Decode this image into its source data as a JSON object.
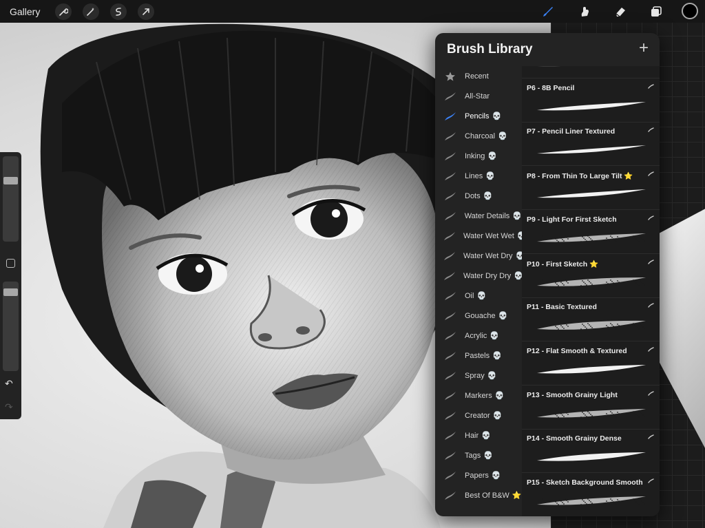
{
  "toolbar": {
    "gallery_label": "Gallery",
    "left_icons": [
      "wrench-icon",
      "magic-wand-icon",
      "selection-icon",
      "transform-arrow-icon"
    ],
    "right_icons": [
      "brush-icon",
      "smudge-icon",
      "eraser-icon",
      "layers-icon"
    ],
    "accent_color": "#3b82f6",
    "active_color": "#000000"
  },
  "sidebar": {
    "brush_size_level": 0.26,
    "opacity_level": 0.07,
    "undo_glyph": "↶",
    "redo_glyph": "↷"
  },
  "brush_library": {
    "title": "Brush Library",
    "add_glyph": "+",
    "sets": [
      {
        "label": "Recent",
        "icon": "star-icon",
        "badge": "",
        "selected": false
      },
      {
        "label": "All-Star",
        "icon": "brush-stroke-icon",
        "badge": "",
        "selected": false
      },
      {
        "label": "Pencils",
        "icon": "brush-stroke-icon",
        "badge": "💀",
        "selected": true
      },
      {
        "label": "Charcoal",
        "icon": "brush-stroke-icon",
        "badge": "💀",
        "selected": false
      },
      {
        "label": "Inking",
        "icon": "brush-stroke-icon",
        "badge": "💀",
        "selected": false
      },
      {
        "label": "Lines",
        "icon": "brush-stroke-icon",
        "badge": "💀",
        "selected": false
      },
      {
        "label": "Dots",
        "icon": "brush-stroke-icon",
        "badge": "💀",
        "selected": false
      },
      {
        "label": "Water Details",
        "icon": "brush-stroke-icon",
        "badge": "💀",
        "selected": false
      },
      {
        "label": "Water Wet Wet",
        "icon": "brush-stroke-icon",
        "badge": "💀",
        "selected": false
      },
      {
        "label": "Water Wet Dry",
        "icon": "brush-stroke-icon",
        "badge": "💀",
        "selected": false
      },
      {
        "label": "Water Dry Dry",
        "icon": "brush-stroke-icon",
        "badge": "💀",
        "selected": false
      },
      {
        "label": "Oil",
        "icon": "brush-stroke-icon",
        "badge": "💀",
        "selected": false
      },
      {
        "label": "Gouache",
        "icon": "brush-stroke-icon",
        "badge": "💀",
        "selected": false
      },
      {
        "label": "Acrylic",
        "icon": "brush-stroke-icon",
        "badge": "💀",
        "selected": false
      },
      {
        "label": "Pastels",
        "icon": "brush-stroke-icon",
        "badge": "💀",
        "selected": false
      },
      {
        "label": "Spray",
        "icon": "brush-stroke-icon",
        "badge": "💀",
        "selected": false
      },
      {
        "label": "Markers",
        "icon": "brush-stroke-icon",
        "badge": "💀",
        "selected": false
      },
      {
        "label": "Creator",
        "icon": "brush-stroke-icon",
        "badge": "💀",
        "selected": false
      },
      {
        "label": "Hair",
        "icon": "brush-stroke-icon",
        "badge": "💀",
        "selected": false
      },
      {
        "label": "Tags",
        "icon": "brush-stroke-icon",
        "badge": "💀",
        "selected": false
      },
      {
        "label": "Papers",
        "icon": "brush-stroke-icon",
        "badge": "💀",
        "selected": false
      },
      {
        "label": "Best Of B&W",
        "icon": "brush-stroke-icon",
        "badge": "⭐",
        "selected": false
      }
    ],
    "brushes": [
      {
        "label": "",
        "star": false
      },
      {
        "label": "P6 - 8B Pencil",
        "star": false
      },
      {
        "label": "P7 - Pencil Liner Textured",
        "star": false
      },
      {
        "label": "P8 - From Thin To Large Tilt",
        "star": true
      },
      {
        "label": "P9 - Light For First Sketch",
        "star": false
      },
      {
        "label": "P10 - First Sketch",
        "star": true
      },
      {
        "label": "P11 - Basic Textured",
        "star": false
      },
      {
        "label": "P12 - Flat Smooth & Textured",
        "star": false
      },
      {
        "label": "P13 - Smooth Grainy Light",
        "star": false
      },
      {
        "label": "P14 - Smooth Grainy Dense",
        "star": false
      },
      {
        "label": "P15 - Sketch  Background Smooth",
        "star": false
      }
    ],
    "star_glyph": "⭐",
    "cloud_glyph": "☁"
  }
}
